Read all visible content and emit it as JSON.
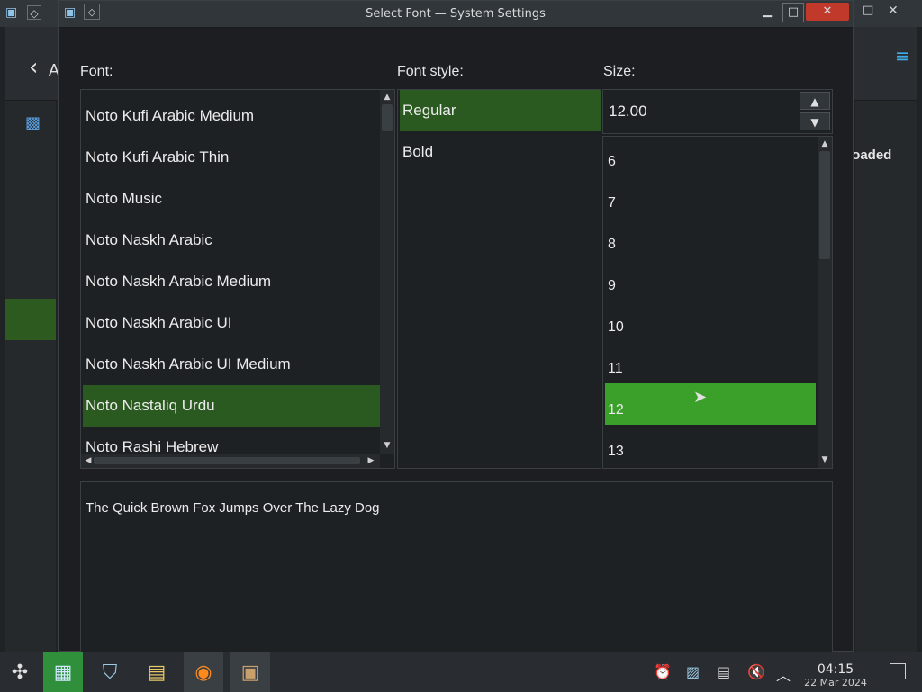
{
  "background_window": {
    "right_text": "loaded",
    "left_text": "A"
  },
  "dialog": {
    "title": "Select Font — System Settings",
    "title_buttons": {
      "minimize": "▁",
      "maximize": "□",
      "close": "✕"
    }
  },
  "labels": {
    "font": "Font:",
    "style": "Font style:",
    "size": "Size:"
  },
  "font_list": [
    "Noto Kufi Arabic Medium",
    "Noto Kufi Arabic Thin",
    "Noto Music",
    "Noto Naskh Arabic",
    "Noto Naskh Arabic Medium",
    "Noto Naskh Arabic UI",
    "Noto Naskh Arabic UI Medium",
    "Noto Nastaliq Urdu",
    "Noto Rashi Hebrew"
  ],
  "font_selected": "Noto Nastaliq Urdu",
  "style_list": [
    "Regular",
    "Bold"
  ],
  "style_selected": "Regular",
  "size_value": "12.00",
  "size_list": [
    "6",
    "7",
    "8",
    "9",
    "10",
    "11",
    "12",
    "13"
  ],
  "size_selected": "12",
  "preview_text": "The Quick Brown Fox Jumps Over The Lazy Dog",
  "taskbar": {
    "time": "04:15",
    "date": "22 Mar 2024"
  },
  "colors": {
    "selection_dark": "#2b5a20",
    "selection_bright": "#3aa02a",
    "accent_blue": "#3daee9"
  }
}
